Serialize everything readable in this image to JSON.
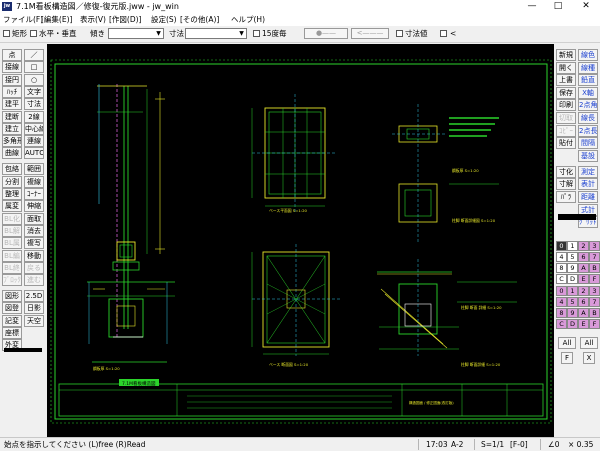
{
  "window": {
    "app_icon": "jw",
    "title": "7.1M看板構造図／修復-復元版.jww - jw_win",
    "minimize": "—",
    "maximize": "□",
    "close": "✕"
  },
  "menu": [
    "ファイル(F)",
    "[編集(E)]",
    "表示(V)",
    "[作図(D)]",
    "設定(S)",
    "[その他(A)]",
    "ヘルプ(H)"
  ],
  "options": {
    "rect_label": "矩形",
    "hv_label": "水平・垂直",
    "slope_label": "傾き",
    "dim_label": "寸法",
    "deg15_label": "15度毎",
    "btn_a": "●——",
    "btn_b": "<———",
    "dimval_label": "寸法値",
    "lt_label": "<"
  },
  "left_tools": [
    [
      "点",
      "／"
    ],
    [
      "接線",
      "□"
    ],
    [
      "接円",
      "○"
    ],
    [
      "ﾊｯﾁ",
      "文字"
    ],
    [
      "建平",
      "寸法"
    ],
    [
      "建断",
      "2線"
    ],
    [
      "建立",
      "中心線"
    ],
    [
      "多角形",
      "連線"
    ],
    [
      "曲線",
      "AUTO"
    ],
    [
      "包絡",
      "範囲"
    ],
    [
      "分割",
      "複線"
    ],
    [
      "整理",
      "ｺｰﾅｰ"
    ],
    [
      "属変",
      "伸縮"
    ],
    [
      "BL化",
      "面取"
    ],
    [
      "BL解",
      "消去"
    ],
    [
      "BL属",
      "複写"
    ],
    [
      "BL編",
      "移動"
    ],
    [
      "BL終",
      "戻る"
    ],
    [
      "ﾌﾞﾛｯｸ",
      "進む"
    ],
    [
      "図形",
      "2.5D"
    ],
    [
      "図登",
      "日影"
    ],
    [
      "記変",
      "天空"
    ],
    [
      "座標",
      ""
    ],
    [
      "外変",
      ""
    ]
  ],
  "left_tools_disabled": [
    "BL化",
    "BL解",
    "BL属",
    "BL編",
    "BL終",
    "ﾌﾞﾛｯｸ",
    "戻る",
    "進む"
  ],
  "right_tools": [
    [
      "新規",
      "線色"
    ],
    [
      "開く",
      "線種"
    ],
    [
      "上書",
      "鉛直"
    ],
    [
      "保存",
      "X軸"
    ],
    [
      "印刷",
      "2点角"
    ],
    [
      "切取",
      "線長"
    ],
    [
      "ｺﾋﾟｰ",
      "2点長"
    ],
    [
      "貼付",
      "間隔"
    ],
    [
      "",
      "基設"
    ],
    [
      "寸化",
      "測定"
    ],
    [
      "寸解",
      "表計"
    ],
    [
      "ﾊﾟﾗ",
      "距離"
    ],
    [
      "",
      "式計"
    ],
    [
      "",
      "ｸﾞﾘｯﾄﾞ"
    ]
  ],
  "right_tools_disabled": [
    "切取",
    "ｺﾋﾟｰ"
  ],
  "layer_panel": {
    "all_label": "All",
    "f_label": "F",
    "x_label": "X",
    "labels": [
      "0",
      "1",
      "2",
      "3",
      "4",
      "5",
      "6",
      "7",
      "8",
      "9",
      "A",
      "B",
      "C",
      "D",
      "E",
      "F"
    ]
  },
  "drawing": {
    "labels": [
      "鋼板厚 S=1:20",
      "ベース平面図 S=1:20",
      "鋼板厚 S=1:20",
      "柱脚 断面詳細図 S=1:20",
      "ベース 断面図 S=1:20",
      "柱脚 断面 詳細 S=1:20",
      "柱脚 断面詳細 S=1:20"
    ],
    "titleblock_name": "7.1M看板構造図",
    "titleblock_sub": "構造図面 / 修正図面(改訂版)"
  },
  "status": {
    "message": "始点を指示してください (L)free (R)Read",
    "scale": "17:03",
    "paper": "A-2",
    "ratio": "S=1/1",
    "layer": "[F-0]",
    "angle": "∠0",
    "zoom": "× 0.35"
  },
  "colors": {
    "canvas_bg": "#000000",
    "green": "#2bd42b",
    "yellow": "#e6e62a",
    "cyan": "#33c8e8",
    "magenta": "#d060d0",
    "white": "#ffffff",
    "accent_blue": "#1a3fd0"
  }
}
